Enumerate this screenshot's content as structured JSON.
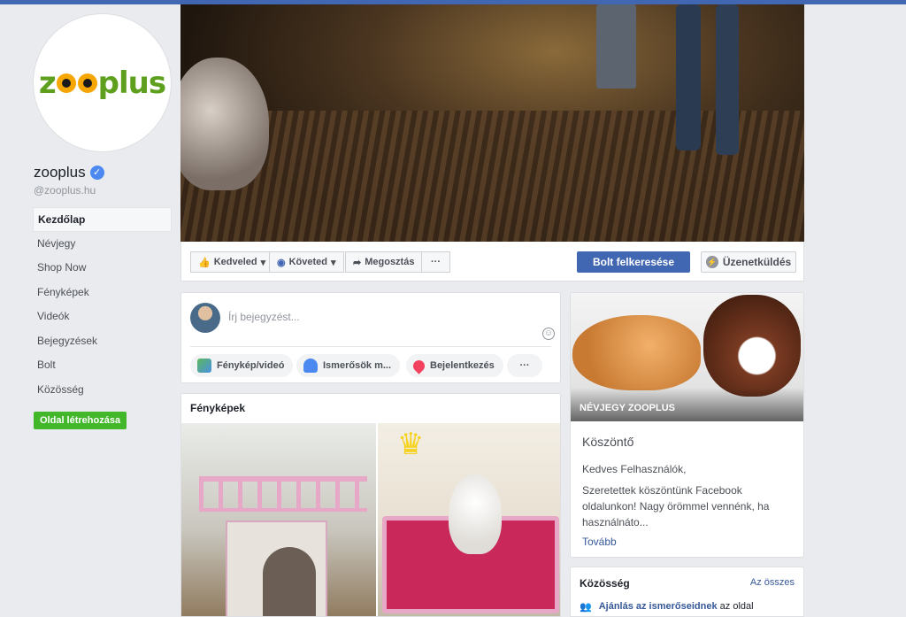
{
  "page": {
    "name": "zooplus",
    "handle": "@zooplus.hu",
    "logo_text": "zooplus"
  },
  "nav": [
    {
      "label": "Kezdőlap",
      "active": true
    },
    {
      "label": "Névjegy"
    },
    {
      "label": "Shop Now"
    },
    {
      "label": "Fényképek"
    },
    {
      "label": "Videók"
    },
    {
      "label": "Bejegyzések"
    },
    {
      "label": "Bolt"
    },
    {
      "label": "Közösség"
    }
  ],
  "create_page_label": "Oldal létrehozása",
  "actions": {
    "like": "Kedveled",
    "follow": "Követed",
    "share": "Megosztás",
    "more": "···",
    "shop": "Bolt felkeresése",
    "message": "Üzenetküldés"
  },
  "composer": {
    "placeholder": "Írj bejegyzést...",
    "photo_video": "Fénykép/videó",
    "tag_friends": "Ismerősök m...",
    "checkin": "Bejelentkezés",
    "more": "···"
  },
  "photos": {
    "title": "Fényképek"
  },
  "about": {
    "label": "NÉVJEGY ZOOPLUS",
    "title": "Köszöntő",
    "greeting": "Kedves Felhasználók,",
    "text": "Szeretettek köszöntünk Facebook oldalunkon! Nagy örömmel vennénk, ha használnáto...",
    "more": "Tovább"
  },
  "community": {
    "title": "Közösség",
    "see_all": "Az összes",
    "row_link": "Ajánlás az ismerőseidnek",
    "row_text": "az oldal"
  },
  "colors": {
    "brand_blue": "#4267b2",
    "brand_green": "#5ea01e",
    "create_green": "#42b72a",
    "link": "#365899"
  }
}
